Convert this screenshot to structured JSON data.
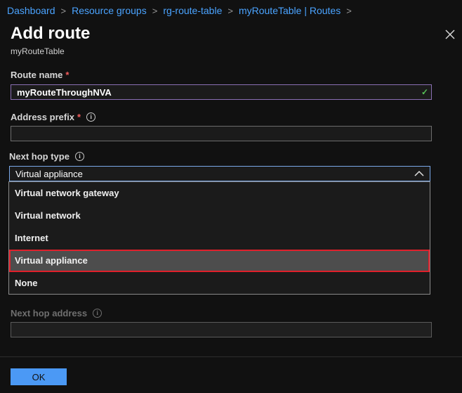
{
  "breadcrumb": [
    "Dashboard",
    "Resource groups",
    "rg-route-table",
    "myRouteTable | Routes"
  ],
  "header": {
    "title": "Add route",
    "subtitle": "myRouteTable"
  },
  "form": {
    "route_name": {
      "label": "Route name",
      "required": "*",
      "value": "myRouteThroughNVA"
    },
    "address_prefix": {
      "label": "Address prefix",
      "required": "*",
      "value": ""
    },
    "next_hop_type": {
      "label": "Next hop type",
      "selected": "Virtual appliance",
      "options": [
        "Virtual network gateway",
        "Virtual network",
        "Internet",
        "Virtual appliance",
        "None"
      ]
    },
    "next_hop_address": {
      "label": "Next hop address",
      "value": ""
    }
  },
  "footer": {
    "ok_label": "OK"
  },
  "colors": {
    "accent": "#4b99f5",
    "link": "#4aa3ff",
    "required": "#f15c5c",
    "highlight": "#e0202b"
  }
}
